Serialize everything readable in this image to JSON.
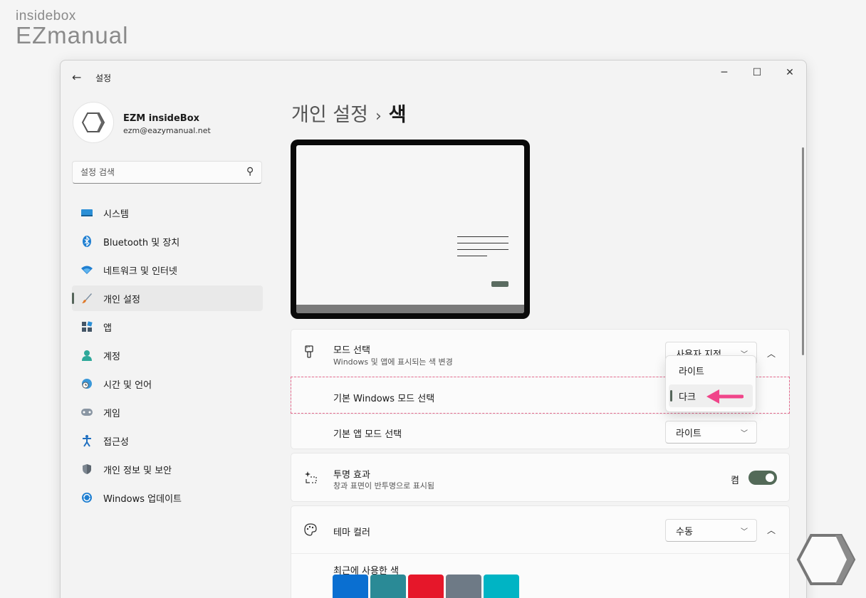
{
  "watermark": {
    "line1": "insidebox",
    "line2": "EZmanual"
  },
  "window": {
    "title": "설정",
    "back_glyph": "←",
    "minimize_glyph": "─",
    "maximize_glyph": "☐",
    "close_glyph": "✕"
  },
  "profile": {
    "name": "EZM insideBox",
    "email": "ezm@eazymanual.net"
  },
  "search": {
    "placeholder": "설정 검색"
  },
  "nav": {
    "items": [
      {
        "label": "시스템",
        "icon": "monitor-icon"
      },
      {
        "label": "Bluetooth 및 장치",
        "icon": "bluetooth-icon"
      },
      {
        "label": "네트워크 및 인터넷",
        "icon": "wifi-icon"
      },
      {
        "label": "개인 설정",
        "icon": "paintbrush-icon",
        "selected": true
      },
      {
        "label": "앱",
        "icon": "apps-icon"
      },
      {
        "label": "계정",
        "icon": "person-icon"
      },
      {
        "label": "시간 및 언어",
        "icon": "globe-clock-icon"
      },
      {
        "label": "게임",
        "icon": "gamepad-icon"
      },
      {
        "label": "접근성",
        "icon": "accessibility-icon"
      },
      {
        "label": "개인 정보 및 보안",
        "icon": "shield-icon"
      },
      {
        "label": "Windows 업데이트",
        "icon": "update-icon"
      }
    ]
  },
  "breadcrumb": {
    "parent": "개인 설정",
    "separator": "›",
    "current": "색"
  },
  "mode_card": {
    "title": "모드 선택",
    "subtitle": "Windows 및 앱에 표시되는 색 변경",
    "value": "사용자 지정",
    "windows_mode_label": "기본 Windows 모드 선택",
    "app_mode_label": "기본 앱 모드 선택",
    "app_mode_value": "라이트",
    "menu_options": [
      "라이트",
      "다크"
    ],
    "menu_selected": "다크"
  },
  "transparency": {
    "title": "투명 효과",
    "subtitle": "창과 표면이 반투명으로 표시됨",
    "state_label": "켬",
    "on": true
  },
  "theme_color": {
    "title": "테마 컬러",
    "value": "수동",
    "recent_label": "최근에 사용한 색",
    "recent_colors": [
      "#0a6fd1",
      "#2a8a96",
      "#e6172a",
      "#6e7a86",
      "#00b4c4"
    ]
  },
  "colors": {
    "accent": "#536a58",
    "arrow": "#f0458a",
    "highlight": "#e46a8e"
  }
}
